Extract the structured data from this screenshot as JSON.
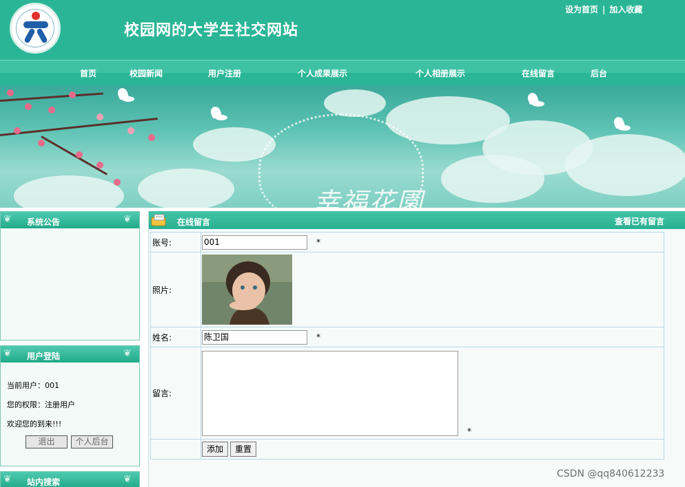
{
  "header": {
    "site_title": "校园网的大学生社交网站",
    "set_home_label": "设为首页",
    "separator": "|",
    "add_favorite_label": "加入收藏"
  },
  "nav": {
    "items": [
      "首页",
      "校园新闻",
      "用户注册",
      "个人成果展示",
      "个人相册展示",
      "在线留言",
      "后台"
    ]
  },
  "banner": {
    "text": "幸福花園"
  },
  "sidebar": {
    "announcement_title": "系统公告",
    "login_title": "用户登陆",
    "current_user_label": "当前用户：",
    "current_user_value": "001",
    "permission_label": "您的权限：",
    "permission_value": "注册用户",
    "welcome_text": "欢迎您的到来!!!",
    "logout_button": "退出",
    "personal_admin_button": "个人后台",
    "search_title": "站内搜索"
  },
  "main": {
    "title": "在线留言",
    "view_messages_link": "查看已有留言",
    "form": {
      "account_label": "账号:",
      "account_value": "001",
      "photo_label": "照片:",
      "name_label": "姓名:",
      "name_value": "陈卫国",
      "message_label": "留言:",
      "message_value": "",
      "required_mark": "*",
      "submit_button": "添加",
      "reset_button": "重置"
    }
  },
  "watermark": "CSDN @qq840612233",
  "colors": {
    "header_green": "#2bb597",
    "nav_light": "#3fc2a4",
    "panel_bg": "#f6fbfa",
    "table_border": "#b9d7e3"
  }
}
